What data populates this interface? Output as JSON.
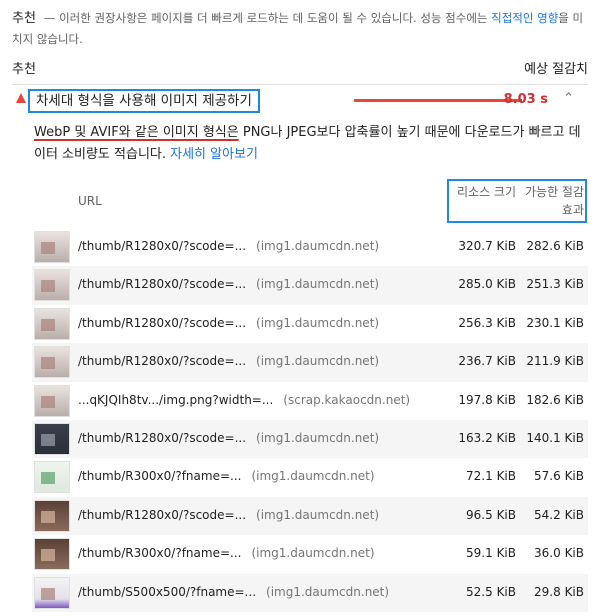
{
  "intro": {
    "heading": "추천",
    "text": "— 이러한 권장사항은 페이지를 더 빠르게 로드하는 데 도움이 될 수 있습니다. 성능 점수에는",
    "link": "직접적인 영향",
    "text_after": "을 미치지 않습니다."
  },
  "columns": {
    "left": "추천",
    "right": "예상 절감치"
  },
  "audit": {
    "title": "차세대 형식을 사용해 이미지 제공하기",
    "savings": "8.03 s",
    "status_color": "#e8453c"
  },
  "description": {
    "part1": "WebP 및 AVIF와 같은 이미지 형식은",
    "part2": " PNG나 JPEG보다 압축률이 높기 때문에 다운로드가 빠르고 데이터 소비량도 적습니다. ",
    "link": "자세히 알아보기"
  },
  "table": {
    "headers": {
      "url": "URL",
      "size": "리소스 크기",
      "savings": "가능한 절감 효과"
    },
    "rows": [
      {
        "url": "/thumb/R1280x0/?scode=...",
        "host": "(img1.daumcdn.net)",
        "size": "320.7 KiB",
        "savings": "282.6 KiB",
        "thumb": "light"
      },
      {
        "url": "/thumb/R1280x0/?scode=...",
        "host": "(img1.daumcdn.net)",
        "size": "285.0 KiB",
        "savings": "251.3 KiB",
        "thumb": "light"
      },
      {
        "url": "/thumb/R1280x0/?scode=...",
        "host": "(img1.daumcdn.net)",
        "size": "256.3 KiB",
        "savings": "230.1 KiB",
        "thumb": "light"
      },
      {
        "url": "/thumb/R1280x0/?scode=...",
        "host": "(img1.daumcdn.net)",
        "size": "236.7 KiB",
        "savings": "211.9 KiB",
        "thumb": "light"
      },
      {
        "url": "...qKJQIh8tv.../img.png?width=...",
        "host": "(scrap.kakaocdn.net)",
        "size": "197.8 KiB",
        "savings": "182.6 KiB",
        "thumb": "light"
      },
      {
        "url": "/thumb/R1280x0/?scode=...",
        "host": "(img1.daumcdn.net)",
        "size": "163.2 KiB",
        "savings": "140.1 KiB",
        "thumb": "dark"
      },
      {
        "url": "/thumb/R300x0/?fname=...",
        "host": "(img1.daumcdn.net)",
        "size": "72.1 KiB",
        "savings": "57.6 KiB",
        "thumb": "green"
      },
      {
        "url": "/thumb/R1280x0/?scode=...",
        "host": "(img1.daumcdn.net)",
        "size": "96.5 KiB",
        "savings": "54.2 KiB",
        "thumb": "photo"
      },
      {
        "url": "/thumb/R300x0/?fname=...",
        "host": "(img1.daumcdn.net)",
        "size": "59.1 KiB",
        "savings": "36.0 KiB",
        "thumb": "photo"
      },
      {
        "url": "/thumb/S500x500/?fname=...",
        "host": "(img1.daumcdn.net)",
        "size": "52.5 KiB",
        "savings": "29.8 KiB",
        "thumb": "purple"
      }
    ]
  }
}
